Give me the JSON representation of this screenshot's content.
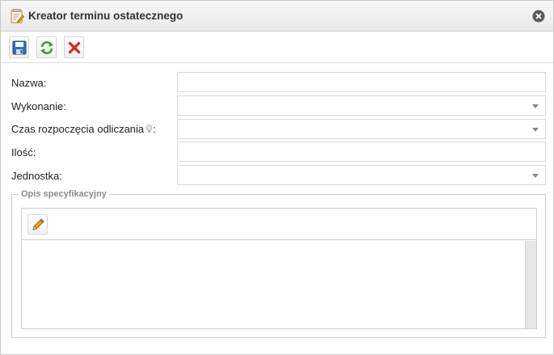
{
  "dialog": {
    "title": "Kreator terminu ostatecznego",
    "title_icon": "form-edit-icon",
    "close_icon": "close-circle-icon"
  },
  "toolbar": {
    "buttons": [
      {
        "icon": "save-disk-icon"
      },
      {
        "icon": "refresh-arrows-icon"
      },
      {
        "icon": "cancel-x-icon"
      }
    ]
  },
  "form": {
    "fields": [
      {
        "label": "Nazwa:",
        "type": "text",
        "value": ""
      },
      {
        "label": "Wykonanie:",
        "type": "select",
        "value": ""
      },
      {
        "label_before_hint": "Czas rozpoczęcia odliczania",
        "label_after_hint": ":",
        "hint_icon": "lightbulb-hint-icon",
        "type": "select",
        "value": ""
      },
      {
        "label": "Ilość:",
        "type": "text",
        "value": ""
      },
      {
        "label": "Jednostka:",
        "type": "select",
        "value": ""
      }
    ]
  },
  "specification": {
    "legend": "Opis specyfikacyjny",
    "edit_icon": "pencil-icon",
    "content": ""
  },
  "colors": {
    "save": "#2f6fc0",
    "refresh": "#3e9a2a",
    "cancel": "#e02020",
    "pencil": "#e8a317"
  }
}
